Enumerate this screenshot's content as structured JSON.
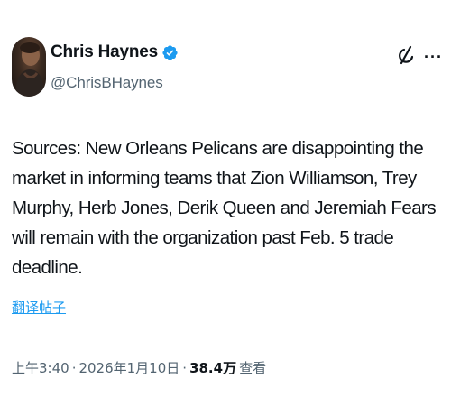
{
  "author": {
    "name": "Chris Haynes",
    "handle": "@ChrisBHaynes",
    "verified": true
  },
  "tweet": {
    "text": "Sources: New Orleans Pelicans are disappointing the market in informing teams that Zion Williamson, Trey Murphy, Herb Jones, Derik Queen and Jeremiah Fears will remain with the organization past Feb. 5 trade deadline.",
    "translate_label": "翻译帖子"
  },
  "meta": {
    "time": "上午3:40",
    "separator": "·",
    "date": "2026年1月10日",
    "views_count": "38.4万",
    "views_label": "查看"
  },
  "icons": {
    "verified": "verified-badge-icon",
    "grok": "grok-icon",
    "more": "more-options-icon"
  },
  "colors": {
    "accent": "#1d9bf0",
    "text": "#0f1419",
    "secondary": "#536471"
  }
}
